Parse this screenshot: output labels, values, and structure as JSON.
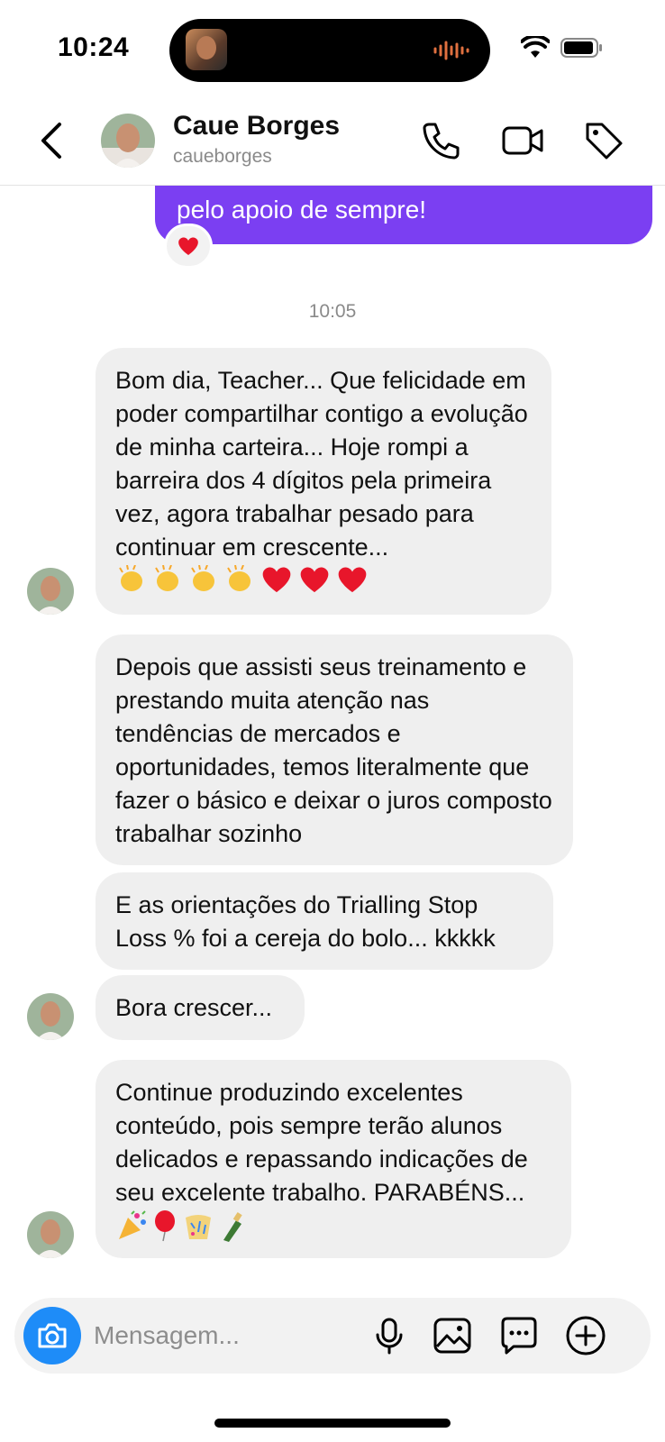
{
  "status_bar": {
    "time": "10:24"
  },
  "header": {
    "contact_name": "Caue Borges",
    "contact_handle": "caueborges",
    "icons": [
      "back-chevron-icon",
      "phone-icon",
      "video-icon",
      "tag-icon"
    ]
  },
  "conversation": {
    "outgoing_tail_text": "pelo apoio de sempre!",
    "outgoing_reaction": "heart",
    "timestamp": "10:05",
    "messages": [
      {
        "text": "Bom dia, Teacher... Que felicidade em poder compartilhar contigo a evolução de minha carteira... Hoje rompi a barreira dos 4 dígitos pela primeira vez, agora trabalhar pesado para continuar em crescente...",
        "emojis": [
          "clap",
          "clap",
          "clap",
          "clap",
          "heart",
          "heart",
          "heart"
        ]
      },
      {
        "text": "Depois que assisti seus treinamento e prestando muita atenção nas tendências de mercados e oportunidades, temos literalmente que fazer o básico e deixar o juros composto trabalhar sozinho"
      },
      {
        "text": "E as orientações do Trialling Stop Loss % foi a cereja do bolo... kkkkk"
      },
      {
        "text": "Bora crescer..."
      },
      {
        "text": "Continue produzindo excelentes conteúdo, pois sempre terão alunos delicados e repassando indicações de seu excelente trabalho. PARABÉNS...",
        "emojis": [
          "party-popper",
          "balloon",
          "confetti",
          "champagne"
        ]
      }
    ]
  },
  "composer": {
    "placeholder": "Mensagem...",
    "icons": [
      "camera-icon",
      "microphone-icon",
      "image-icon",
      "sticker-icon",
      "plus-icon"
    ]
  },
  "colors": {
    "outgoing_bubble": "#7b3ff2",
    "incoming_bubble": "#efefef",
    "camera_button": "#1e8cf8"
  }
}
